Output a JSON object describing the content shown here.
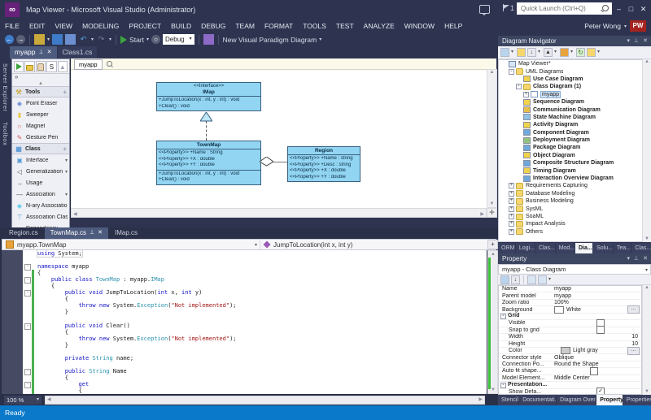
{
  "window": {
    "title": "Map Viewer - Microsoft Visual Studio (Administrator)",
    "quick_launch": "Quick Launch (Ctrl+Q)",
    "notification_count": "1",
    "user": "Peter Wong",
    "user_initials": "PW",
    "minimize": "–",
    "maximize": "□",
    "close": "✕"
  },
  "menu": {
    "items": [
      "FILE",
      "EDIT",
      "VIEW",
      "MODELING",
      "PROJECT",
      "BUILD",
      "DEBUG",
      "TEAM",
      "FORMAT",
      "TOOLS",
      "TEST",
      "ANALYZE",
      "WINDOW",
      "HELP"
    ]
  },
  "toolbar": {
    "start_label": "Start",
    "debug_label": "Debug",
    "vp_label": "New Visual Paradigm Diagram"
  },
  "doc_tabs": [
    {
      "label": "myapp",
      "active": true,
      "closable": true
    },
    {
      "label": "Class1.cs",
      "active": false,
      "closable": false
    }
  ],
  "side_tabs": [
    "Server Explorer",
    "Toolbox"
  ],
  "palette": {
    "sections": [
      {
        "title": "Tools",
        "icon": "tools",
        "items": [
          {
            "label": "Point Eraser",
            "icon": "eraser"
          },
          {
            "label": "Sweeper",
            "icon": "sweeper"
          },
          {
            "label": "Magnet",
            "icon": "magnet"
          },
          {
            "label": "Gesture Pen",
            "icon": "pen"
          }
        ]
      },
      {
        "title": "Class",
        "icon": "class",
        "items": [
          {
            "label": "Interface",
            "icon": "interface",
            "dropdown": true
          },
          {
            "label": "Generalization",
            "icon": "generalization",
            "dropdown": true
          },
          {
            "label": "Usage",
            "icon": "usage"
          },
          {
            "label": "Association",
            "icon": "association",
            "dropdown": true
          },
          {
            "label": "N-ary Association",
            "icon": "nary"
          },
          {
            "label": "Association Class",
            "icon": "assocclass"
          },
          {
            "label": "Dependency",
            "icon": "dependency",
            "dropdown": true
          }
        ]
      }
    ]
  },
  "canvas": {
    "view_tab": "myapp",
    "classes": [
      {
        "stereotype": "<<Interface>>",
        "name": "IMap",
        "attributes": [],
        "operations": [
          "+JumpToLocation(x : int, y : int) : void",
          "+Clear() : void"
        ]
      },
      {
        "name": "TownMap",
        "attributes": [
          "<<Property>> +Name : String",
          "<<Property>> +X : double",
          "<<Property>> +Y : double"
        ],
        "operations": [
          "+JumpToLocation(x : int, y : int) : void",
          "+Clear() : void"
        ]
      },
      {
        "name": "Region",
        "attributes": [
          "<<Property>> +Name : string",
          "<<Property>> +Desc : string",
          "<<Property>> +X : double",
          "<<Property>> +Y : double"
        ],
        "operations": []
      }
    ]
  },
  "editor": {
    "tabs": [
      {
        "label": "Region.cs",
        "active": false,
        "closable": false
      },
      {
        "label": "TownMap.cs",
        "active": true,
        "closable": true
      },
      {
        "label": "IMap.cs",
        "active": false,
        "closable": false
      }
    ],
    "nav_type": "myapp.TownMap",
    "nav_member": "JumpToLocation(int x, int y)",
    "zoom": "100 %",
    "code_lines": [
      {
        "cur": true,
        "tokens": [
          [
            "kw",
            "using"
          ],
          [
            "pl",
            " System;"
          ]
        ]
      },
      {
        "tokens": []
      },
      {
        "outline": true,
        "tokens": [
          [
            "kw",
            "namespace"
          ],
          [
            "pl",
            " myapp"
          ]
        ]
      },
      {
        "bar": true,
        "tokens": [
          [
            "pl",
            "{"
          ]
        ]
      },
      {
        "bar": true,
        "outline": true,
        "tokens": [
          [
            "pl",
            "    "
          ],
          [
            "kw",
            "public"
          ],
          [
            "pl",
            " "
          ],
          [
            "kw",
            "class"
          ],
          [
            "pl",
            " "
          ],
          [
            "ty",
            "TownMap"
          ],
          [
            "pl",
            " : myapp."
          ],
          [
            "ty",
            "IMap"
          ]
        ]
      },
      {
        "bar": true,
        "tokens": [
          [
            "pl",
            "    {"
          ]
        ]
      },
      {
        "bar": true,
        "outline": true,
        "tokens": [
          [
            "pl",
            "        "
          ],
          [
            "kw",
            "public"
          ],
          [
            "pl",
            " "
          ],
          [
            "kw",
            "void"
          ],
          [
            "pl",
            " JumpToLocation("
          ],
          [
            "kw",
            "int"
          ],
          [
            "pl",
            " x, "
          ],
          [
            "kw",
            "int"
          ],
          [
            "pl",
            " y)"
          ]
        ]
      },
      {
        "bar": true,
        "tokens": [
          [
            "pl",
            "        {"
          ]
        ]
      },
      {
        "bar": true,
        "tokens": [
          [
            "pl",
            "            "
          ],
          [
            "kw",
            "throw"
          ],
          [
            "pl",
            " "
          ],
          [
            "kw",
            "new"
          ],
          [
            "pl",
            " System."
          ],
          [
            "ty",
            "Exception"
          ],
          [
            "pl",
            "("
          ],
          [
            "str",
            "\"Not implemented\""
          ],
          [
            "pl",
            ");"
          ]
        ]
      },
      {
        "bar": true,
        "tokens": [
          [
            "pl",
            "        }"
          ]
        ]
      },
      {
        "bar": true,
        "tokens": []
      },
      {
        "bar": true,
        "outline": true,
        "tokens": [
          [
            "pl",
            "        "
          ],
          [
            "kw",
            "public"
          ],
          [
            "pl",
            " "
          ],
          [
            "kw",
            "void"
          ],
          [
            "pl",
            " Clear()"
          ]
        ]
      },
      {
        "bar": true,
        "tokens": [
          [
            "pl",
            "        {"
          ]
        ]
      },
      {
        "bar": true,
        "tokens": [
          [
            "pl",
            "            "
          ],
          [
            "kw",
            "throw"
          ],
          [
            "pl",
            " "
          ],
          [
            "kw",
            "new"
          ],
          [
            "pl",
            " System."
          ],
          [
            "ty",
            "Exception"
          ],
          [
            "pl",
            "("
          ],
          [
            "str",
            "\"Not implemented\""
          ],
          [
            "pl",
            ");"
          ]
        ]
      },
      {
        "bar": true,
        "tokens": [
          [
            "pl",
            "        }"
          ]
        ]
      },
      {
        "bar": true,
        "tokens": []
      },
      {
        "bar": true,
        "tokens": [
          [
            "pl",
            "        "
          ],
          [
            "kw",
            "private"
          ],
          [
            "pl",
            " "
          ],
          [
            "ty",
            "String"
          ],
          [
            "pl",
            " name;"
          ]
        ]
      },
      {
        "bar": true,
        "tokens": []
      },
      {
        "bar": true,
        "outline": true,
        "tokens": [
          [
            "pl",
            "        "
          ],
          [
            "kw",
            "public"
          ],
          [
            "pl",
            " "
          ],
          [
            "ty",
            "String"
          ],
          [
            "pl",
            " Name"
          ]
        ]
      },
      {
        "bar": true,
        "tokens": [
          [
            "pl",
            "        {"
          ]
        ]
      },
      {
        "bar": true,
        "outline": true,
        "tokens": [
          [
            "pl",
            "            "
          ],
          [
            "kw",
            "get"
          ]
        ]
      },
      {
        "bar": true,
        "tokens": [
          [
            "pl",
            "            {"
          ]
        ]
      }
    ]
  },
  "navigator": {
    "title": "Diagram Navigator",
    "tree": [
      {
        "label": "Map Viewer*",
        "depth": 0,
        "icon": "proj"
      },
      {
        "label": "UML Diagrams",
        "depth": 1,
        "expander": "-",
        "icon": "folder"
      },
      {
        "label": "Use Case Diagram",
        "depth": 2,
        "icon": "sq",
        "color": "#F0D24B",
        "bold": true
      },
      {
        "label": "Class Diagram (1)",
        "depth": 2,
        "expander": "-",
        "icon": "folder",
        "bold": true
      },
      {
        "label": "myapp",
        "depth": 3,
        "expander": "+",
        "icon": "page",
        "selected": true
      },
      {
        "label": "Sequence Diagram",
        "depth": 2,
        "icon": "sq",
        "color": "#F0D24B",
        "bold": true
      },
      {
        "label": "Communication Diagram",
        "depth": 2,
        "icon": "sq",
        "color": "#E8C04B",
        "bold": true
      },
      {
        "label": "State Machine Diagram",
        "depth": 2,
        "icon": "sq",
        "color": "#8FC3E8",
        "bold": true
      },
      {
        "label": "Activity Diagram",
        "depth": 2,
        "icon": "sq",
        "color": "#F0D24B",
        "bold": true
      },
      {
        "label": "Component Diagram",
        "depth": 2,
        "icon": "sq",
        "color": "#6FA8DC",
        "bold": true
      },
      {
        "label": "Deployment Diagram",
        "depth": 2,
        "icon": "sq",
        "color": "#93C47D",
        "bold": true
      },
      {
        "label": "Package Diagram",
        "depth": 2,
        "icon": "sq",
        "color": "#6FA8DC",
        "bold": true
      },
      {
        "label": "Object Diagram",
        "depth": 2,
        "icon": "sq",
        "color": "#F0D24B",
        "bold": true
      },
      {
        "label": "Composite Structure Diagram",
        "depth": 2,
        "icon": "sq",
        "color": "#6FA8DC",
        "bold": true
      },
      {
        "label": "Timing Diagram",
        "depth": 2,
        "icon": "sq",
        "color": "#F0D24B",
        "bold": true
      },
      {
        "label": "Interaction Overview Diagram",
        "depth": 2,
        "icon": "sq",
        "color": "#6FA8DC",
        "bold": true
      },
      {
        "label": "Requirements Capturing",
        "depth": 1,
        "expander": "+",
        "icon": "folder"
      },
      {
        "label": "Database Modeling",
        "depth": 1,
        "expander": "+",
        "icon": "folder"
      },
      {
        "label": "Business Modeling",
        "depth": 1,
        "expander": "+",
        "icon": "folder"
      },
      {
        "label": "SysML",
        "depth": 1,
        "expander": "+",
        "icon": "folder"
      },
      {
        "label": "SoaML",
        "depth": 1,
        "expander": "+",
        "icon": "folder"
      },
      {
        "label": "Impact Analysis",
        "depth": 1,
        "expander": "+",
        "icon": "folder"
      },
      {
        "label": "Others",
        "depth": 1,
        "expander": "+",
        "icon": "folder"
      }
    ]
  },
  "right_tabs_mid": [
    {
      "label": "ORM"
    },
    {
      "label": "Logi..."
    },
    {
      "label": "Clas..."
    },
    {
      "label": "Mod..."
    },
    {
      "label": "Dia...",
      "active": true
    },
    {
      "label": "Solu..."
    },
    {
      "label": "Tea..."
    },
    {
      "label": "Clas..."
    }
  ],
  "property": {
    "title": "Property",
    "selector": "myapp - Class Diagram",
    "rows": [
      {
        "name": "Name",
        "value": "myapp"
      },
      {
        "name": "Parent model",
        "value": "myapp"
      },
      {
        "name": "Zoom ratio",
        "value": "100%"
      },
      {
        "name": "Background",
        "value": "White",
        "swatch": "#FFFFFF",
        "more": true
      },
      {
        "name": "Grid",
        "group": true
      },
      {
        "name": "Visible",
        "indent": 1,
        "checkbox": "unchecked"
      },
      {
        "name": "Snap to grid",
        "indent": 1,
        "checkbox": "unchecked"
      },
      {
        "name": "Width",
        "indent": 1,
        "value": "10",
        "align": "right"
      },
      {
        "name": "Height",
        "indent": 1,
        "value": "10",
        "align": "right"
      },
      {
        "name": "Color",
        "indent": 1,
        "value": "Light gray",
        "swatch": "#CCCCCC",
        "more": true
      },
      {
        "name": "Connector style",
        "value": "Oblique"
      },
      {
        "name": "Connection Po...",
        "value": "Round the Shape"
      },
      {
        "name": "Auto fit shape...",
        "checkbox": "unchecked"
      },
      {
        "name": "Model Element...",
        "value": "Middle Center"
      },
      {
        "name": "Presentation...",
        "group": true
      },
      {
        "name": "Show Defa...",
        "indent": 1,
        "checkbox": "checked"
      }
    ]
  },
  "right_tabs_bottom": [
    {
      "label": "Stencil"
    },
    {
      "label": "Documentati..."
    },
    {
      "label": "Diagram Over..."
    },
    {
      "label": "Property",
      "active": true
    },
    {
      "label": "Properties"
    }
  ],
  "status": {
    "text": "Ready"
  }
}
